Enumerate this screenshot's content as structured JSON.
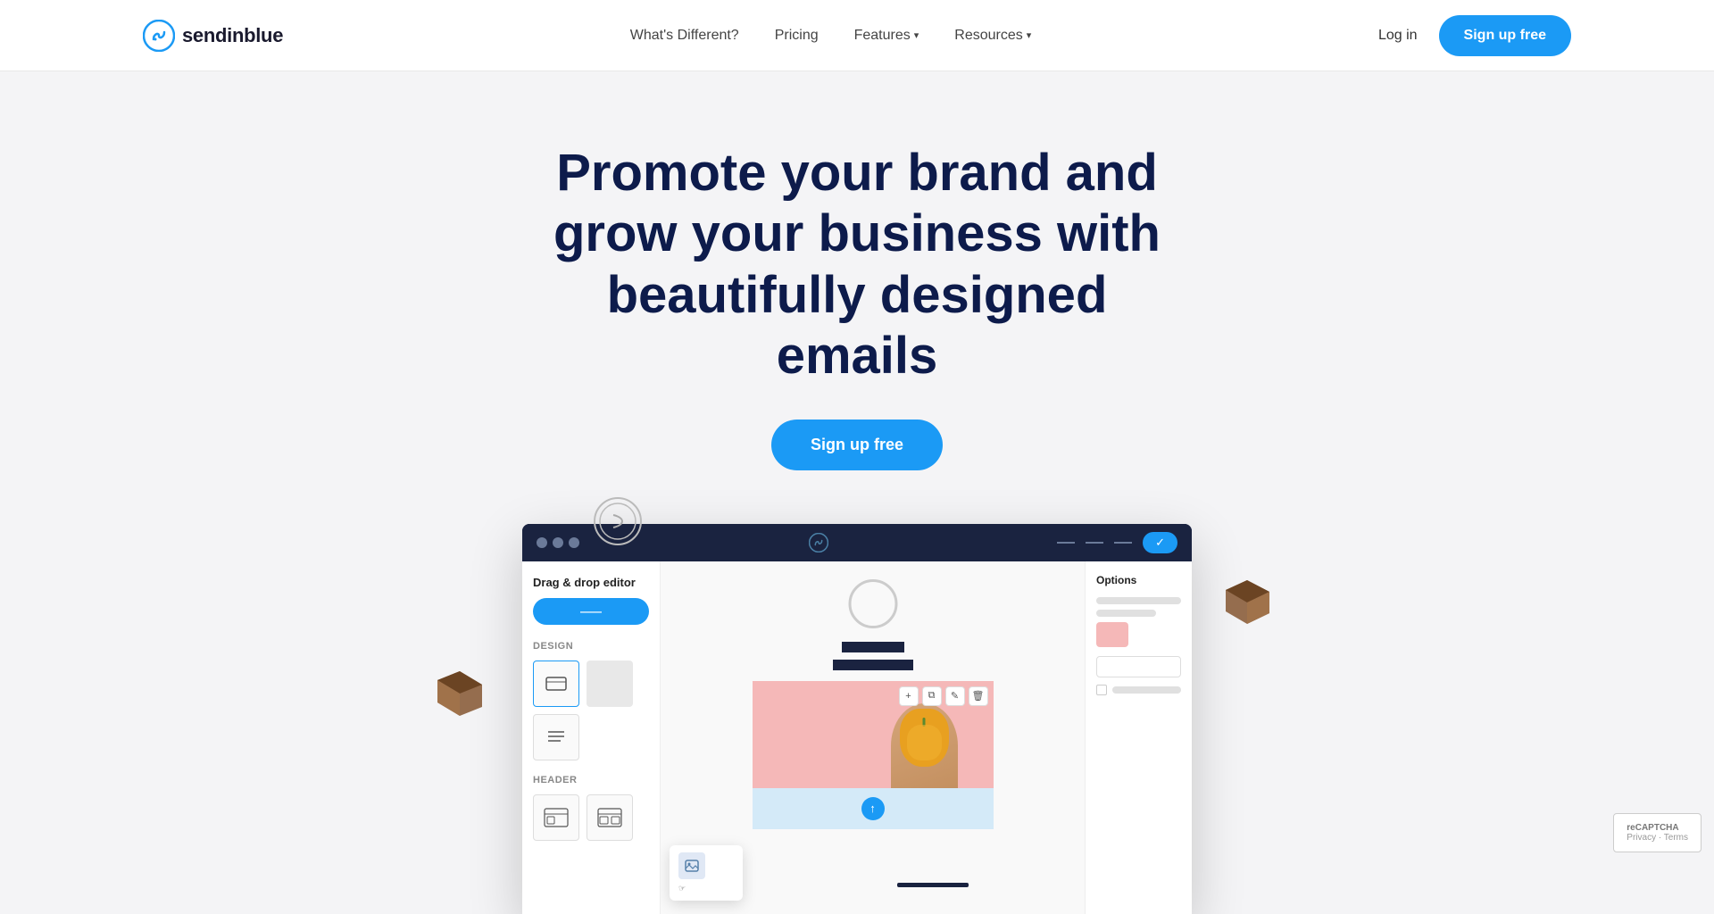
{
  "nav": {
    "logo_text": "sendinblue",
    "links": [
      {
        "label": "What's Different?",
        "has_arrow": false
      },
      {
        "label": "Pricing",
        "has_arrow": false
      },
      {
        "label": "Features",
        "has_arrow": true
      },
      {
        "label": "Resources",
        "has_arrow": true
      }
    ],
    "login_label": "Log in",
    "signup_label": "Sign up free"
  },
  "hero": {
    "title_line1": "Promote your brand and",
    "title_line2": "grow your business with",
    "title_line3": "beautifully designed emails",
    "signup_label": "Sign up free"
  },
  "app": {
    "titlebar": {
      "checkmark": "✓"
    },
    "sidebar": {
      "title": "Drag & drop editor",
      "btn_label": "——",
      "design_label": "Design",
      "header_label": "Header"
    },
    "options": {
      "title": "Options"
    }
  },
  "recaptcha": {
    "text": "reCAPTCHA",
    "subtext": "Privacy · Terms"
  }
}
